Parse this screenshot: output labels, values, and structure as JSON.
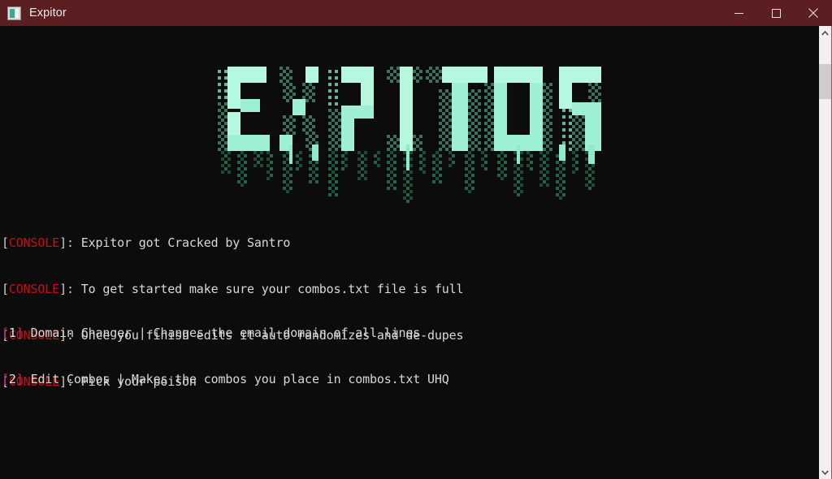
{
  "window": {
    "title": "Expitor",
    "icon": "app-window-icon",
    "titlebar_color": "#5c1f21",
    "controls": [
      {
        "name": "minimize",
        "glyph": "minimize-icon"
      },
      {
        "name": "maximize",
        "glyph": "maximize-icon"
      },
      {
        "name": "close",
        "glyph": "close-icon"
      }
    ]
  },
  "terminal": {
    "background": "#0c0c0c",
    "text_color": "#d6d6d6",
    "banner": {
      "text": "EXPITOR",
      "style": "ascii-glitch-art",
      "color_bright": "#aaf5dc",
      "color_mid": "#7fe3c0",
      "color_drip": "#1f6b52"
    },
    "console": {
      "prefix_open": "[",
      "prefix_label": "CONSOLE",
      "prefix_close": "]: ",
      "label_color": "#c90f0f",
      "lines": [
        "Expitor got Cracked by Santro",
        "To get started make sure your combos.txt file is full",
        "Once you finish edits it auto randomizes and de-dupes",
        "Pick your poison"
      ]
    },
    "menu": {
      "bracket_color": "#c4246b",
      "items": [
        {
          "num": "1",
          "label": "Domain Changer",
          "sep": " | ",
          "desc": "Changes the email domain of all lines"
        },
        {
          "num": "2",
          "label": "Edit Combos",
          "sep": " | ",
          "desc": "Makes the combos you place in combos.txt UHQ"
        }
      ]
    }
  },
  "scrollbar": {
    "up_arrow": "chevron-up-icon",
    "down_arrow": "chevron-down-icon",
    "thumb_position_percent": 5
  }
}
